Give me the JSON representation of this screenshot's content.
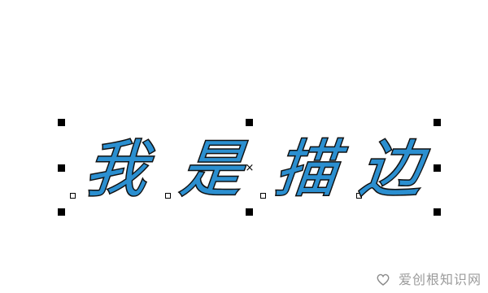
{
  "selection": {
    "text": [
      "我",
      "是",
      "描",
      "边"
    ],
    "fill_color": "#2b8fd0",
    "outline_color": "#111111",
    "handles": [
      "top-left",
      "top-middle",
      "top-right",
      "middle-left",
      "middle-right",
      "bottom-left",
      "bottom-middle",
      "bottom-right"
    ],
    "center_mark": "×"
  },
  "watermark": {
    "text": "爱创根知识网"
  }
}
